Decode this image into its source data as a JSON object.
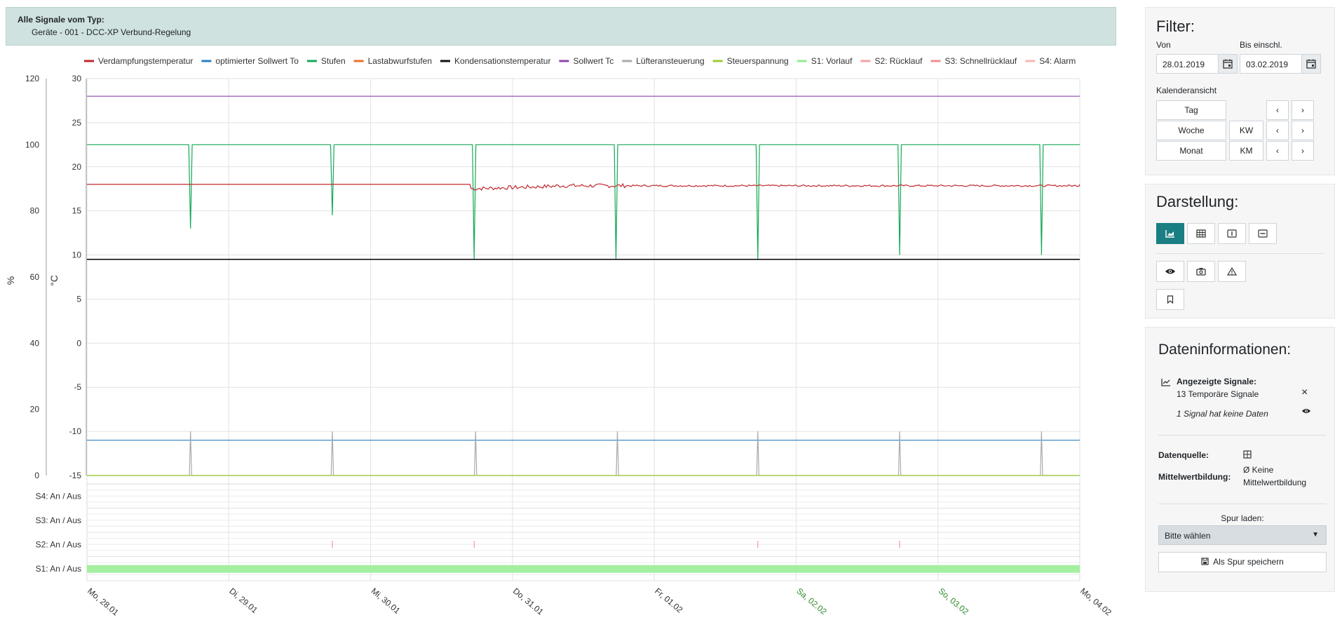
{
  "header": {
    "title": "Alle Signale vom Typ:",
    "subtitle": "Geräte - 001 - DCC-XP Verbund-Regelung"
  },
  "chart_data": {
    "type": "line",
    "legend": [
      {
        "name": "Verdampfungstemperatur",
        "color": "#c0282e"
      },
      {
        "name": "optimierter Sollwert To",
        "color": "#2a7fc1"
      },
      {
        "name": "Stufen",
        "color": "#15a857"
      },
      {
        "name": "Lastabwurfstufen",
        "color": "#e8702a"
      },
      {
        "name": "Kondensationstemperatur",
        "color": "#111111"
      },
      {
        "name": "Sollwert Tc",
        "color": "#8e44ad"
      },
      {
        "name": "Lüfteransteuerung",
        "color": "#aaaaaa"
      },
      {
        "name": "Steuerspannung",
        "color": "#9acd32"
      },
      {
        "name": "S1: Vorlauf",
        "color": "#90ee90"
      },
      {
        "name": "S2: Rücklauf",
        "color": "#f4a2a2"
      },
      {
        "name": "S3: Schnellrücklauf",
        "color": "#f08c8c"
      },
      {
        "name": "S4: Alarm",
        "color": "#f7b6b6"
      }
    ],
    "left_axis": {
      "label": "%",
      "ticks": [
        "120",
        "100",
        "80",
        "60",
        "40",
        "20",
        "0"
      ],
      "ylim": [
        0,
        120
      ]
    },
    "right_axis": {
      "label": "°C",
      "ticks": [
        "30",
        "25",
        "20",
        "15",
        "10",
        "5",
        "0",
        "-5",
        "-10",
        "-15"
      ],
      "ylim": [
        -15,
        30
      ]
    },
    "x_ticks": [
      {
        "label": "Mo, 28.01",
        "weekend": false
      },
      {
        "label": "Di, 29.01",
        "weekend": false
      },
      {
        "label": "Mi, 30.01",
        "weekend": false
      },
      {
        "label": "Do, 31.01",
        "weekend": false
      },
      {
        "label": "Fr, 01.02",
        "weekend": false
      },
      {
        "label": "Sa, 02.02",
        "weekend": true
      },
      {
        "label": "So, 03.02",
        "weekend": true
      },
      {
        "label": "Mo, 04.02",
        "weekend": false
      }
    ],
    "xlim_days": [
      0,
      7
    ],
    "series": [
      {
        "name": "Sollwert Tc",
        "axis": "°C",
        "value": 28
      },
      {
        "name": "Stufen",
        "axis": "°C",
        "base": 22.5,
        "dips": [
          {
            "day": 0.73,
            "to": 13
          },
          {
            "day": 1.73,
            "to": 14.5
          },
          {
            "day": 2.73,
            "to": 9.5
          },
          {
            "day": 3.73,
            "to": 9.5
          },
          {
            "day": 4.73,
            "to": 9.5
          },
          {
            "day": 5.73,
            "to": 10
          },
          {
            "day": 6.73,
            "to": 10
          }
        ]
      },
      {
        "name": "Verdampfungstemperatur",
        "axis": "°C",
        "value": 18,
        "noisy_from_day": 2.7,
        "noisy_value": 17.8
      },
      {
        "name": "Kondensationstemperatur",
        "axis": "°C",
        "value": 9.5
      },
      {
        "name": "optimierter Sollwert To",
        "axis": "°C",
        "value": -11
      },
      {
        "name": "Lüfteransteuerung",
        "axis": "°C",
        "base": -15,
        "spikes": [
          {
            "day": 0.73,
            "to": -10
          },
          {
            "day": 1.73,
            "to": -10
          },
          {
            "day": 2.74,
            "to": -10
          },
          {
            "day": 3.74,
            "to": -10
          },
          {
            "day": 4.73,
            "to": -10
          },
          {
            "day": 5.73,
            "to": -10
          },
          {
            "day": 6.73,
            "to": -10
          }
        ]
      },
      {
        "name": "Steuerspannung",
        "axis": "°C",
        "value": -15
      }
    ],
    "digital_rows": [
      {
        "label": "S4: An / Aus",
        "events": []
      },
      {
        "label": "S3: An / Aus",
        "events": []
      },
      {
        "label": "S2: An / Aus",
        "events": [
          1.73,
          2.73,
          4.73,
          5.73
        ]
      },
      {
        "label": "S1: An / Aus",
        "on": true
      }
    ]
  },
  "filter": {
    "title": "Filter:",
    "von_label": "Von",
    "von_value": "28.01.2019",
    "bis_label": "Bis einschl.",
    "bis_value": "03.02.2019",
    "kalender_label": "Kalenderansicht",
    "tag": "Tag",
    "woche": "Woche",
    "monat": "Monat",
    "kw": "KW",
    "km": "KM",
    "prev": "‹",
    "next": "›"
  },
  "darstellung": {
    "title": "Darstellung:"
  },
  "info": {
    "title": "Dateninformationen:",
    "signals_label": "Angezeigte Signale:",
    "signals_value": "13 Temporäre Signale",
    "no_data": "1 Signal hat keine Daten",
    "close": "×",
    "quelle_label": "Datenquelle:",
    "mittel_label": "Mittelwertbildung:",
    "mittel_value_1": "Ø Keine",
    "mittel_value_2": "Mittelwertbildung",
    "spur_label": "Spur laden:",
    "spur_select": "Bitte wählen",
    "spur_save": "Als Spur speichern"
  },
  "colors": {
    "accent": "#1b7e83",
    "header_bg": "#cfe2df",
    "weekend": "#2e8b2e"
  }
}
